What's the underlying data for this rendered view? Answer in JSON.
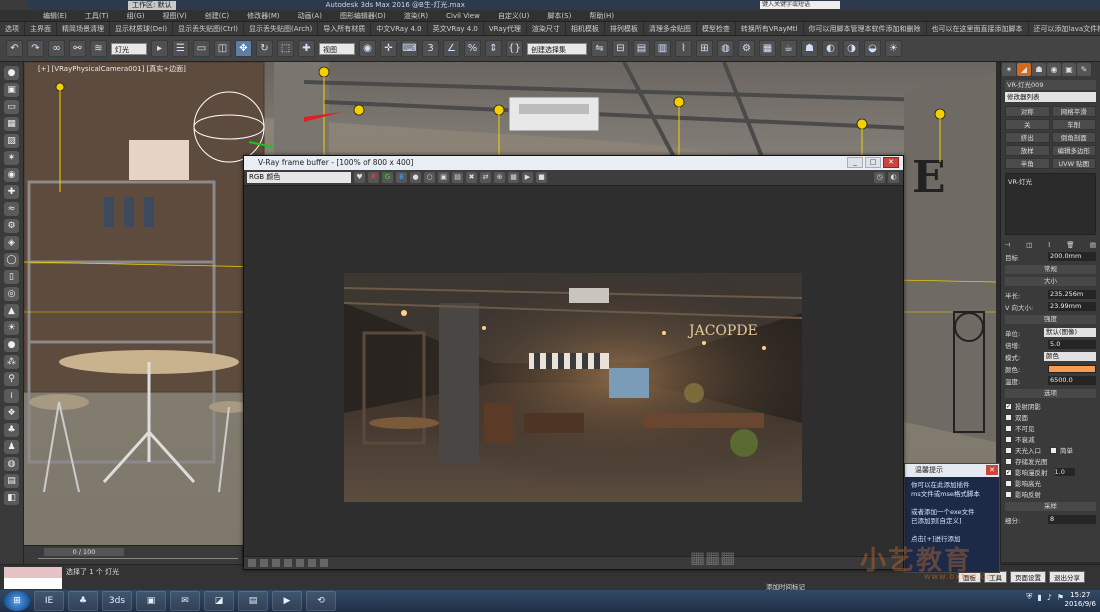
{
  "titlebar": {
    "workspace": "工作区: 默认",
    "title": "Autodesk 3ds Max 2016   @B生-灯光.max",
    "search_placeholder": "键入关键字或短语"
  },
  "menu": [
    "编辑(E)",
    "工具(T)",
    "组(G)",
    "视图(V)",
    "创建(C)",
    "修改器(M)",
    "动画(A)",
    "图形编辑器(D)",
    "渲染(R)",
    "Civil View",
    "自定义(U)",
    "脚本(S)",
    "帮助(H)"
  ],
  "scriptbar": [
    "选项",
    "主界面",
    "精简场景清理",
    "显示材质球(Del)",
    "显示丢失贴图(Ctrl)",
    "显示丢失贴图(Arch)",
    "导入所有材质",
    "中文VRay 4.0",
    "英文VRay 4.0",
    "VRay代理",
    "渲染尺寸",
    "相机模板",
    "排列模板",
    "清理多余贴图",
    "模型检查",
    "转换所有VRayMtl",
    "你可以用脚本管理本软件添加和删除",
    "也可以在这里面直接添加脚本",
    "还可以添加lava文件框"
  ],
  "toolbar": {
    "selection_filter": "灯光",
    "ref_coord": "视图",
    "named_sel": "创建选择集"
  },
  "viewport": {
    "label": "[+] [VRayPhysicalCamera001] [真实+边面]"
  },
  "vfb": {
    "title": "V-Ray frame buffer - [100% of 800 x 400]",
    "channel": "RGB 颜色",
    "min": "_",
    "max": "□",
    "close": "✕"
  },
  "right_panel": {
    "light_name": "VR-灯光009",
    "modifier_list": "修改器列表",
    "buttons": [
      "对称",
      "网格平滑",
      "关",
      "车削",
      "挤出",
      "倒角剖面",
      "放样",
      "编辑多边形",
      "半角",
      "UVW 贴图"
    ],
    "stack_item": "VR-灯光",
    "section_general": "常规",
    "section_size": "大小",
    "half_length_label": "半长:",
    "half_length": "235.256m",
    "half_width_label": "V 向大小:",
    "half_width": "23.99mm",
    "section_intensity": "强度",
    "units_label": "单位:",
    "units": "默认(图像)",
    "multiplier_label": "倍增:",
    "multiplier": "5.0",
    "mode_label": "模式:",
    "mode": "颜色",
    "color_label": "颜色:",
    "temperature_label": "温度:",
    "temperature": "6500.0",
    "section_options": "选项",
    "options": [
      {
        "label": "投射阴影",
        "checked": true
      },
      {
        "label": "双面",
        "checked": false
      },
      {
        "label": "不可见",
        "checked": false
      },
      {
        "label": "不衰减",
        "checked": false
      },
      {
        "label": "天光入口",
        "checked": false
      },
      {
        "label": "存储发光图",
        "checked": false
      },
      {
        "label": "影响漫反射",
        "checked": true
      },
      {
        "label": "影响高光",
        "checked": false
      },
      {
        "label": "影响反射",
        "checked": false
      }
    ],
    "simple_label": "简单",
    "affect_value": "1.0",
    "section_sampling": "采样",
    "subdivs_label": "细分:",
    "subdivs": "8",
    "size_label": "目标",
    "size": "200.0mm"
  },
  "popup": {
    "title": "温馨提示",
    "lines": [
      "你可以在此添加插件",
      "ms文件或mse格式脚本",
      "",
      "或者添加一个exe文件",
      "已添加到[自定义]",
      "",
      "点击[+]进行添加"
    ]
  },
  "timeline": {
    "slider": "0 / 100"
  },
  "status": {
    "selection": "选择了 1 个 灯光",
    "add_tag": "添加时间标记",
    "right_buttons": [
      "面板",
      "工具",
      "页面设置",
      "退出分享"
    ]
  },
  "watermark": {
    "text": "小艺教育",
    "sub": "www.bxtop.com"
  },
  "taskbar": {
    "apps": [
      "IE",
      "♣",
      "3ds",
      "▣",
      "✉",
      "◪",
      "▤",
      "▶",
      "⟲"
    ],
    "time": "15:27",
    "date": "2016/9/6"
  },
  "colors": {
    "accent": "#d06a1f",
    "vfb_title": "#e9eef5",
    "light_color": "#f59c52"
  }
}
